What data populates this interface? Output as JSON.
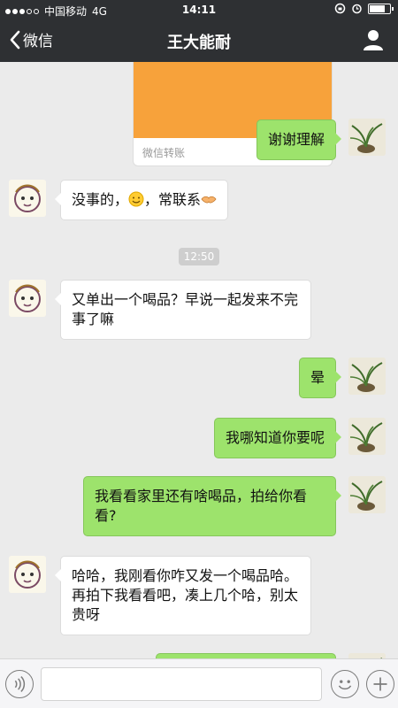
{
  "status_bar": {
    "carrier": "中国移动",
    "network": "4G",
    "time": "14:11"
  },
  "nav": {
    "back_label": "微信",
    "title": "王大能耐"
  },
  "transfer_card": {
    "label": "微信转账"
  },
  "messages": [
    {
      "side": "right",
      "text": "谢谢理解"
    },
    {
      "side": "left",
      "text_before": "没事的，",
      "text_after": "，常联系"
    },
    {
      "side": "right",
      "text": "晕"
    },
    {
      "side": "left",
      "text": "又单出一个喝品？早说一起发来不完事了嘛"
    },
    {
      "side": "right",
      "text": "我哪知道你要呢"
    },
    {
      "side": "right",
      "text": "我看看家里还有啥喝品，拍给你看看?"
    },
    {
      "side": "left",
      "text": "哈哈，我刚看你咋又发一个喝品哈。再拍下我看看吧，凑上几个哈，别太贵呀"
    }
  ],
  "timestamp": "12:50",
  "icons": {
    "back": "chevron-left-icon",
    "profile": "person-icon",
    "voice": "voice-icon",
    "emoji": "smiley-icon",
    "plus": "plus-icon",
    "shield": "shield-icon"
  },
  "colors": {
    "navbar": "#2e3033",
    "sent_bubble": "#9de36c",
    "received_bubble": "#ffffff",
    "transfer": "#f7a23b",
    "chat_bg": "#ebebeb"
  }
}
